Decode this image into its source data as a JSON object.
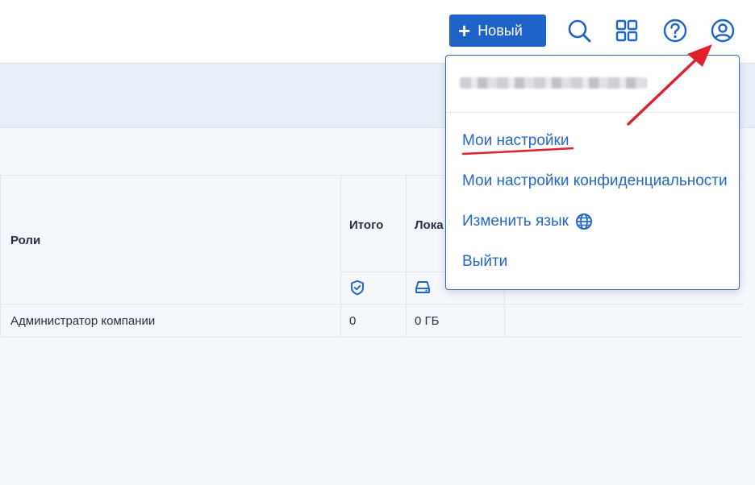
{
  "header": {
    "new_button_label": "Новый",
    "icons": [
      "plus-icon",
      "search-icon",
      "apps-grid-icon",
      "help-icon",
      "user-account-icon"
    ],
    "accent_color": "#1e63c8"
  },
  "table": {
    "columns": {
      "roles": "Роли",
      "total": "Итого",
      "local": "Лока"
    },
    "column_icons": [
      "shield-check-icon",
      "hard-drive-icon"
    ],
    "rows": [
      {
        "role": "Администратор компании",
        "total": "0",
        "local": "0 ГБ"
      }
    ]
  },
  "user_menu": {
    "items": [
      {
        "label": "Мои настройки"
      },
      {
        "label": "Мои настройки конфиденциальности"
      },
      {
        "label": "Изменить язык",
        "icon": "globe-icon"
      },
      {
        "label": "Выйти"
      }
    ],
    "link_color": "#2566c7"
  },
  "annotations": {
    "color": "#e0202a",
    "underline_target": "Мои настройки",
    "arrow_target": "user-account-icon"
  }
}
